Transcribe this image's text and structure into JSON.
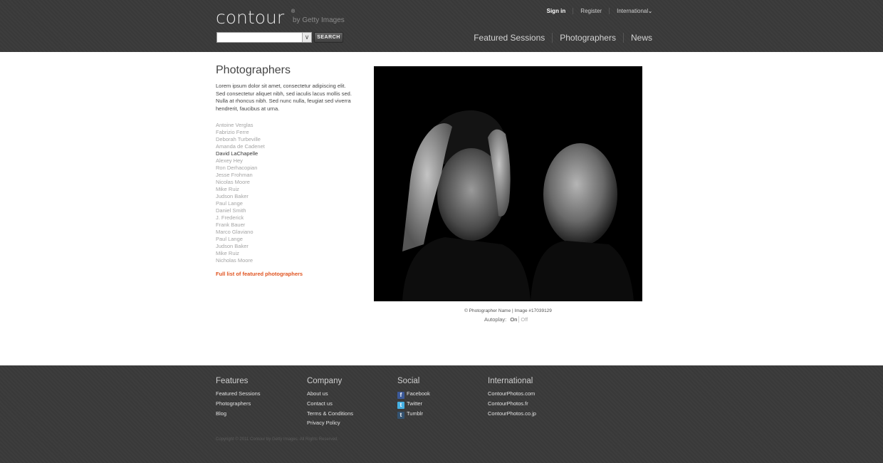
{
  "header": {
    "logo": "contour",
    "logo_reg": "®",
    "logo_by": "by Getty Images",
    "search": {
      "placeholder": "",
      "button_label": "SEARCH"
    },
    "top_links": [
      "Sign in",
      "Register",
      "International"
    ],
    "nav": [
      "Featured Sessions",
      "Photographers",
      "News"
    ]
  },
  "main": {
    "title": "Photographers",
    "intro": "Lorem ipsum dolor sit amet, consectetur adipiscing elit. Sed consectetur aliquet nibh, sed iaculis lacus mollis sed. Nulla at rhoncus nibh. Sed nunc nulla, feugiat sed viverra hendrerit, faucibus at urna.",
    "photographers": [
      {
        "name": "Antoine Verglas",
        "active": false
      },
      {
        "name": "Fabrizio Ferre",
        "active": false
      },
      {
        "name": "Deborah Turbeville",
        "active": false
      },
      {
        "name": "Amanda de Cadenet",
        "active": false
      },
      {
        "name": "David LaChapelle",
        "active": true
      },
      {
        "name": "Alexey Hey",
        "active": false
      },
      {
        "name": "Ron Derhacopian",
        "active": false
      },
      {
        "name": "Jesse Frohman",
        "active": false
      },
      {
        "name": "Nicolas Moore",
        "active": false
      },
      {
        "name": "Mike Ruiz",
        "active": false
      },
      {
        "name": "Judson Baker",
        "active": false
      },
      {
        "name": "Paul Lange",
        "active": false
      },
      {
        "name": "Daniel Smith",
        "active": false
      },
      {
        "name": "J. Frederick",
        "active": false
      },
      {
        "name": "Frank Bauer",
        "active": false
      },
      {
        "name": "Marco Glaviano",
        "active": false
      },
      {
        "name": "Paul Lange",
        "active": false
      },
      {
        "name": "Judson Baker",
        "active": false
      },
      {
        "name": "Mike Ruiz",
        "active": false
      },
      {
        "name": "Nicholas Moore",
        "active": false
      }
    ],
    "full_list_link": "Full list of featured photographers",
    "caption": "© Photographer Name  |  Image #17039129",
    "autoplay": {
      "label": "Autoplay:",
      "on": "On",
      "off": "Off"
    }
  },
  "footer": {
    "columns": [
      {
        "title": "Features",
        "items": [
          "Featured Sessions",
          "Photographers",
          "Blog"
        ]
      },
      {
        "title": "Company",
        "items": [
          "About us",
          "Contact us",
          "Terms & Conditions",
          "Privacy Policy"
        ]
      },
      {
        "title": "Social",
        "items": [
          "Facebook",
          "Twitter",
          "Tumblr"
        ]
      },
      {
        "title": "International",
        "items": [
          "ContourPhotos.com",
          "ContourPhotos.fr",
          "ContourPhotos.co.jp"
        ]
      }
    ],
    "copyright": "Copyright © 2011 Contour by Getty Images. All Rights Reserved."
  }
}
